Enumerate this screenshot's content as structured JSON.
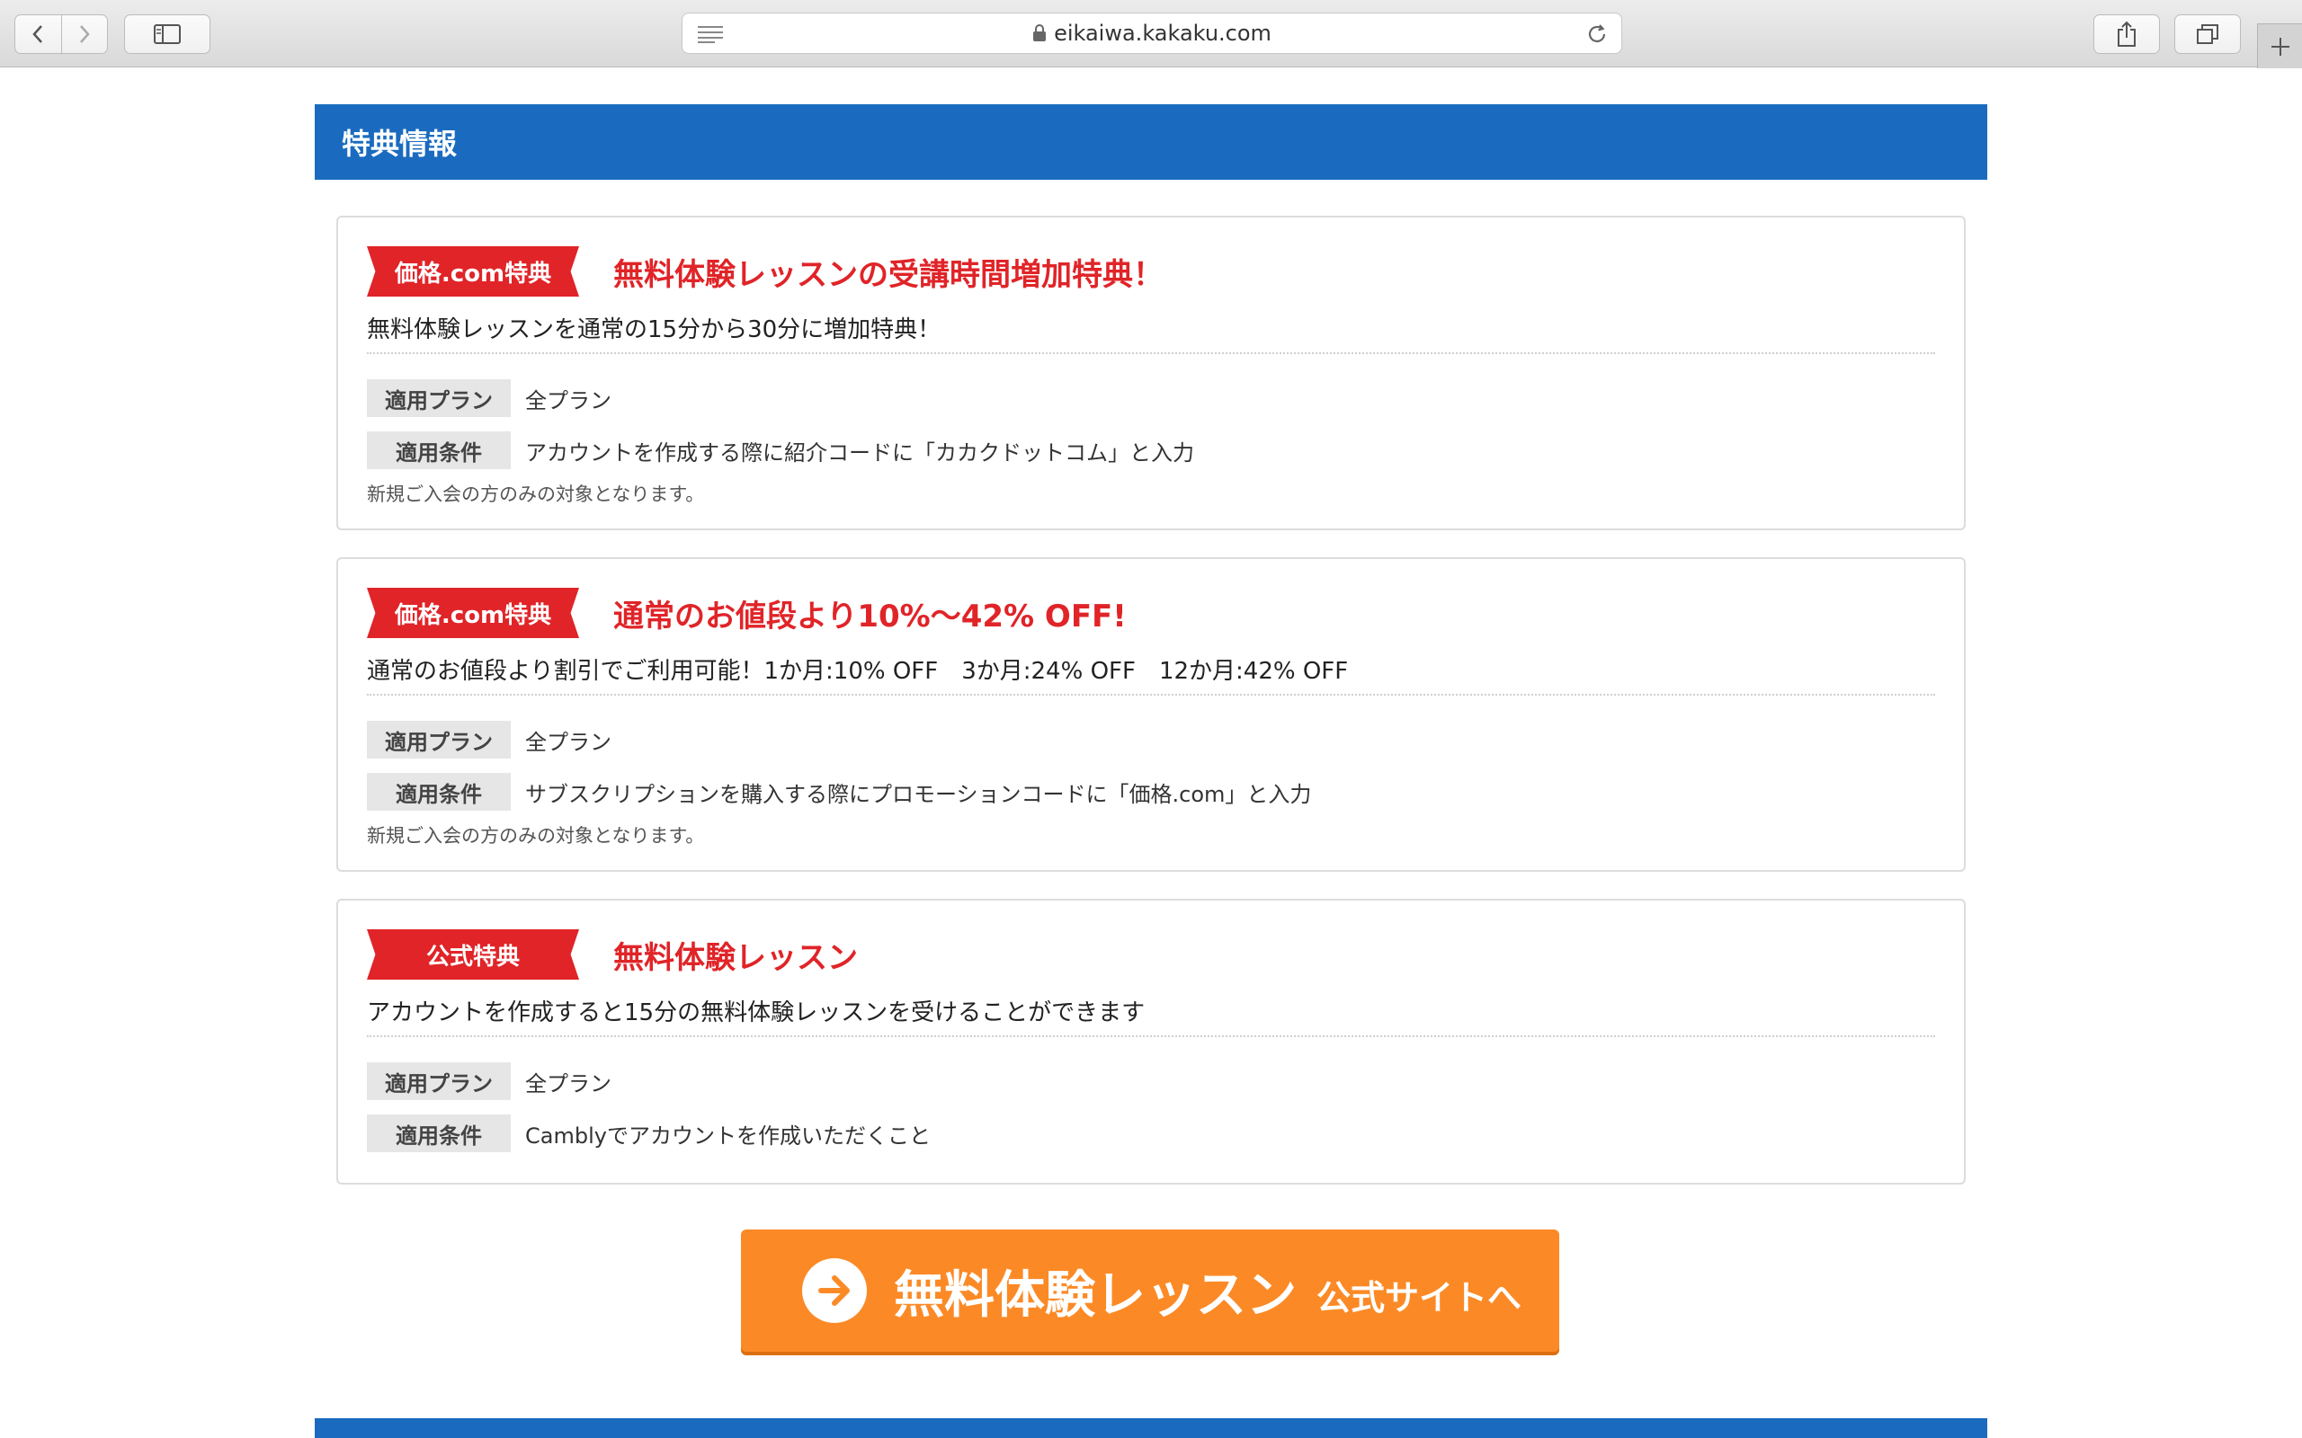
{
  "browser": {
    "url": "eikaiwa.kakaku.com"
  },
  "section": {
    "title": "特典情報"
  },
  "labels": {
    "plan": "適用プラン",
    "condition": "適用条件"
  },
  "cards": [
    {
      "badge": "価格.com特典",
      "title": "無料体験レッスンの受講時間増加特典！",
      "description": "無料体験レッスンを通常の15分から30分に増加特典！",
      "plan": "全プラン",
      "condition": "アカウントを作成する際に紹介コードに「カカクドットコム」と入力",
      "note": "新規ご入会の方のみの対象となります。"
    },
    {
      "badge": "価格.com特典",
      "title": "通常のお値段より10%〜42% OFF!",
      "description": "通常のお値段より割引でご利用可能！1か月:10% OFF　3か月:24% OFF　12か月:42% OFF",
      "plan": "全プラン",
      "condition": "サブスクリプションを購入する際にプロモーションコードに「価格.com」と入力",
      "note": "新規ご入会の方のみの対象となります。"
    },
    {
      "badge": "公式特典",
      "title": "無料体験レッスン",
      "description": "アカウントを作成すると15分の無料体験レッスンを受けることができます",
      "plan": "全プラン",
      "condition": "Camblyでアカウントを作成いただくこと"
    }
  ],
  "cta": {
    "main": "無料体験レッスン",
    "sub": "公式サイトへ"
  },
  "colors": {
    "header_blue": "#1a6bbf",
    "badge_red": "#e02428",
    "cta_orange": "#fb8a26"
  }
}
